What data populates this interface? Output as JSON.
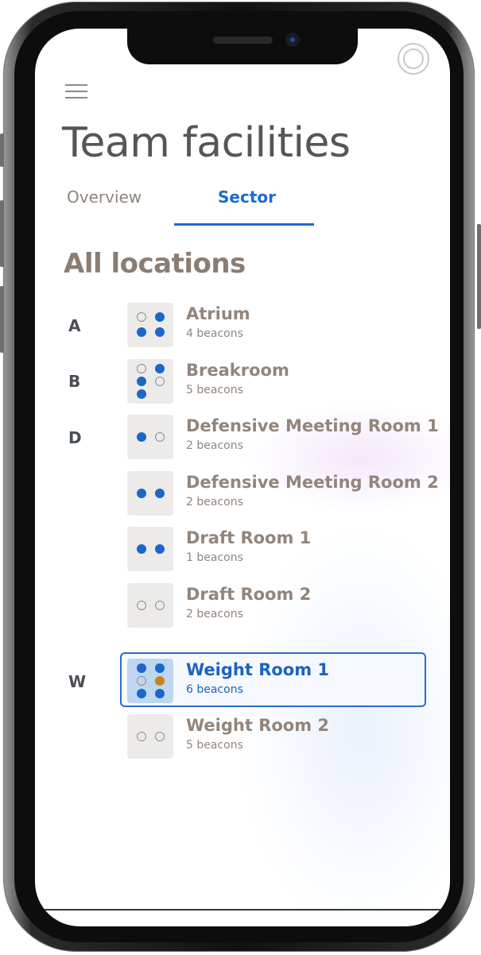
{
  "app": {
    "title": "Team facilities",
    "tabs": [
      {
        "label": "Overview",
        "active": false
      },
      {
        "label": "Sector",
        "active": true
      }
    ],
    "section_title": "All locations"
  },
  "groups": [
    {
      "letter": "A"
    },
    {
      "letter": "B"
    },
    {
      "letter": "D"
    },
    {
      "letter": "W"
    }
  ],
  "locations": [
    {
      "name": "Atrium",
      "count": "4 beacons",
      "dots": [
        "empty",
        "filled",
        "filled",
        "filled"
      ]
    },
    {
      "name": "Breakroom",
      "count": "5 beacons",
      "dots": [
        "empty",
        "filled",
        "filled",
        "empty",
        "filled"
      ]
    },
    {
      "name": "Defensive Meeting Room 1",
      "count": "2 beacons",
      "dots": [
        "filled",
        "empty"
      ]
    },
    {
      "name": "Defensive Meeting Room 2",
      "count": "2 beacons",
      "dots": [
        "filled",
        "filled"
      ]
    },
    {
      "name": "Draft Room 1",
      "count": "1 beacons",
      "dots": [
        "filled",
        "filled"
      ]
    },
    {
      "name": "Draft Room 2",
      "count": "2 beacons",
      "dots": [
        "empty",
        "empty"
      ]
    },
    {
      "name": "Weight Room 1",
      "count": "6 beacons",
      "selected": true,
      "dots": [
        "filled",
        "filled",
        "empty",
        "orange",
        "filled",
        "filled"
      ]
    },
    {
      "name": "Weight Room 2",
      "count": "5 beacons",
      "dots": [
        "empty",
        "empty"
      ]
    }
  ],
  "colors": {
    "accent": "#1d6ad0",
    "beacon_active": "#1b66c9",
    "beacon_alert": "#c98419",
    "muted_text": "#93857b"
  },
  "icons": {
    "menu": "hamburger-menu-icon"
  }
}
